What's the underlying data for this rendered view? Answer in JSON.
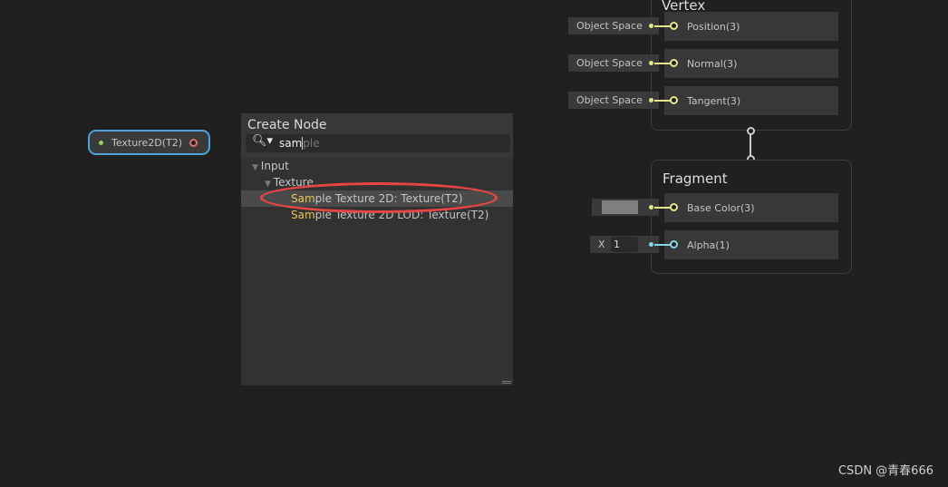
{
  "property_node": {
    "label": "Texture2D(T2)",
    "in_color": "#8fd35a",
    "out_color": "#e07070"
  },
  "create_node": {
    "title": "Create Node",
    "search": {
      "typed": "sam",
      "suggestion": "ple"
    },
    "tree": [
      {
        "label": "Input",
        "level": 0
      },
      {
        "label": "Texture",
        "level": 1
      },
      {
        "match": "Sam",
        "rest": "ple Texture 2D: Texture(T2)",
        "level": 2,
        "selected": true
      },
      {
        "match": "Sam",
        "rest": "ple Texture 2D LOD: Texture(T2)",
        "level": 2
      }
    ]
  },
  "vertex": {
    "title": "Vertex",
    "slots": [
      {
        "label": "Position(3)",
        "input": "Object Space"
      },
      {
        "label": "Normal(3)",
        "input": "Object Space"
      },
      {
        "label": "Tangent(3)",
        "input": "Object Space"
      }
    ]
  },
  "fragment": {
    "title": "Fragment",
    "slots": [
      {
        "label": "Base Color(3)",
        "color_value": "#808080"
      },
      {
        "label": "Alpha(1)",
        "axis": "X",
        "value": "1"
      }
    ]
  },
  "colors": {
    "vector3": "#e6e68a",
    "float": "#84d8e6",
    "highlight": "#e6c555",
    "annotation": "#e84545"
  },
  "watermark": "CSDN @青春666"
}
